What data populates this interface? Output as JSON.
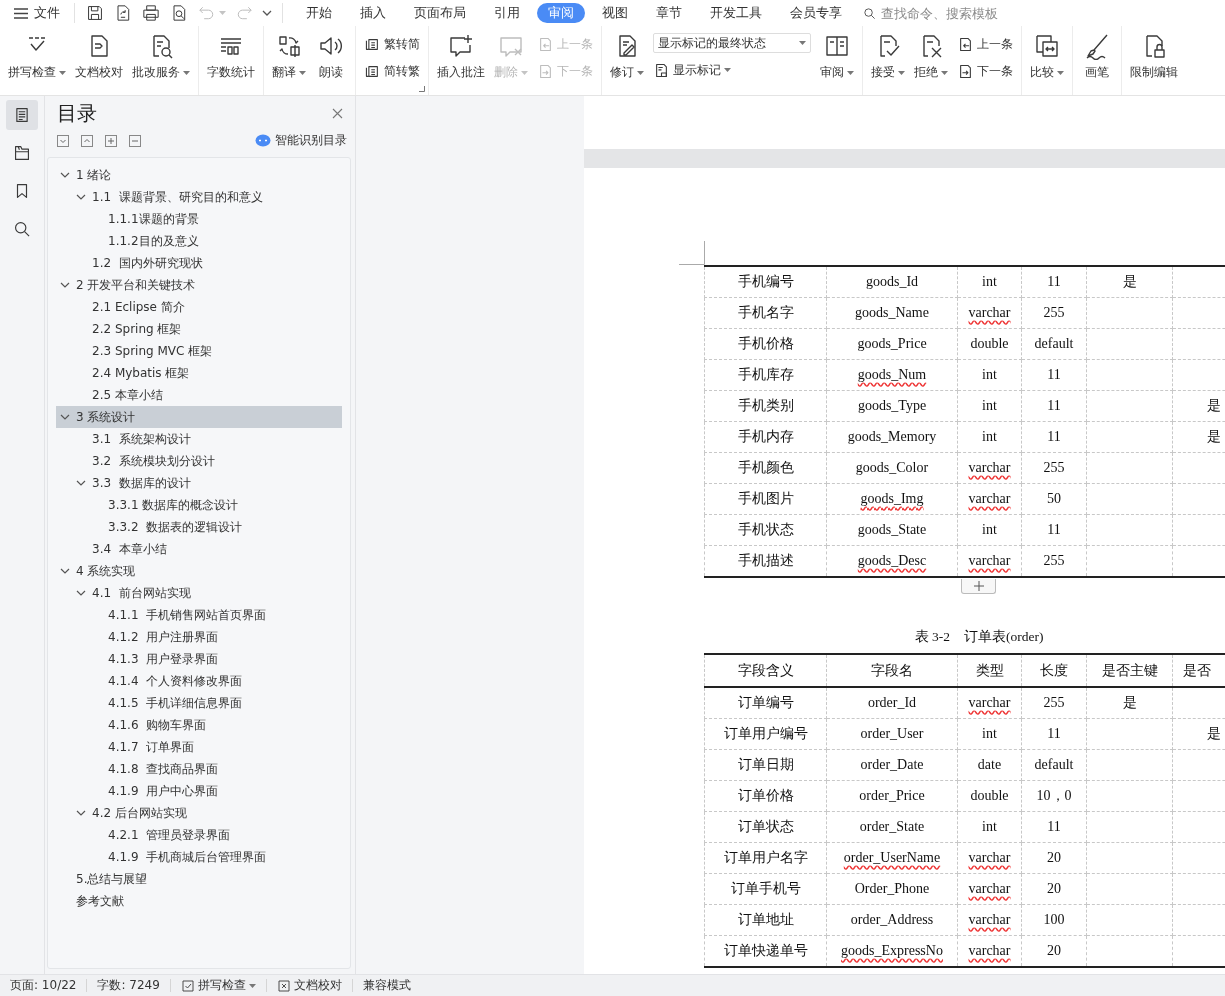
{
  "menu_bar": {
    "file_label": "文件",
    "quick_access": [
      {
        "disabled": false
      },
      {
        "disabled": false
      },
      {
        "disabled": false
      },
      {
        "disabled": false
      },
      {
        "disabled": true
      },
      {
        "disabled": true
      }
    ],
    "tabs": [
      {
        "label": "开始",
        "selected": false
      },
      {
        "label": "插入",
        "selected": false
      },
      {
        "label": "页面布局",
        "selected": false
      },
      {
        "label": "引用",
        "selected": false
      },
      {
        "label": "审阅",
        "selected": true
      },
      {
        "label": "视图",
        "selected": false
      },
      {
        "label": "章节",
        "selected": false
      },
      {
        "label": "开发工具",
        "selected": false
      },
      {
        "label": "会员专享",
        "selected": false
      }
    ],
    "search": {
      "placeholder": "查找命令、搜索模板"
    }
  },
  "ribbon": {
    "groups": [
      {
        "launcher": false,
        "items": [
          {
            "kind": "large",
            "label": "拼写检查",
            "dropdown": true,
            "disabled": false
          },
          {
            "kind": "large",
            "label": "文档校对",
            "dropdown": false,
            "disabled": false
          },
          {
            "kind": "large",
            "label": "批改服务",
            "dropdown": true,
            "disabled": false
          }
        ]
      },
      {
        "launcher": false,
        "items": [
          {
            "kind": "large",
            "label": "字数统计",
            "dropdown": false,
            "disabled": false
          }
        ]
      },
      {
        "launcher": false,
        "items": [
          {
            "kind": "large",
            "label": "翻译",
            "dropdown": true,
            "disabled": false
          },
          {
            "kind": "large",
            "label": "朗读",
            "dropdown": false,
            "disabled": false
          }
        ]
      },
      {
        "launcher": true,
        "items": [
          {
            "kind": "stack",
            "rows": [
              {
                "kind": "button",
                "label": "繁转简",
                "dropdown": false,
                "disabled": false
              },
              {
                "kind": "button",
                "label": "简转繁",
                "dropdown": false,
                "disabled": false
              }
            ]
          }
        ]
      },
      {
        "launcher": false,
        "items": [
          {
            "kind": "large",
            "label": "插入批注",
            "dropdown": false,
            "disabled": false
          },
          {
            "kind": "large",
            "label": "删除",
            "dropdown": true,
            "disabled": true
          },
          {
            "kind": "stack",
            "rows": [
              {
                "kind": "button",
                "label": "上一条",
                "dropdown": false,
                "disabled": true
              },
              {
                "kind": "button",
                "label": "下一条",
                "dropdown": false,
                "disabled": true
              }
            ]
          }
        ]
      },
      {
        "launcher": false,
        "items": [
          {
            "kind": "large",
            "label": "修订",
            "dropdown": true,
            "disabled": false
          },
          {
            "kind": "stack",
            "rows": [
              {
                "kind": "select",
                "value": "显示标记的最终状态"
              },
              {
                "kind": "button",
                "label": "显示标记",
                "dropdown": true,
                "disabled": false
              }
            ]
          },
          {
            "kind": "large",
            "label": "审阅",
            "dropdown": true,
            "disabled": false
          }
        ]
      },
      {
        "launcher": false,
        "items": [
          {
            "kind": "large",
            "label": "接受",
            "dropdown": true,
            "disabled": false
          },
          {
            "kind": "large",
            "label": "拒绝",
            "dropdown": true,
            "disabled": false
          },
          {
            "kind": "stack",
            "rows": [
              {
                "kind": "button",
                "label": "上一条",
                "dropdown": false,
                "disabled": false
              },
              {
                "kind": "button",
                "label": "下一条",
                "dropdown": false,
                "disabled": false
              }
            ]
          }
        ]
      },
      {
        "launcher": false,
        "items": [
          {
            "kind": "large",
            "label": "比较",
            "dropdown": true,
            "disabled": false
          }
        ]
      },
      {
        "launcher": false,
        "items": [
          {
            "kind": "large",
            "label": "画笔",
            "dropdown": false,
            "disabled": false
          }
        ]
      },
      {
        "launcher": false,
        "items": [
          {
            "kind": "large",
            "label": "限制编辑",
            "dropdown": false,
            "disabled": false
          }
        ]
      }
    ]
  },
  "nav_rail": [
    {
      "selected": true
    },
    {
      "selected": false
    },
    {
      "selected": false
    },
    {
      "selected": false
    }
  ],
  "outline": {
    "title": "目录",
    "smart_button": "智能识别目录",
    "items": [
      {
        "label": "1 绪论",
        "expanded": true,
        "selected": false,
        "children": [
          {
            "label": "1.1  课题背景、研究目的和意义",
            "expanded": true,
            "selected": false,
            "children": [
              {
                "label": "1.1.1课题的背景",
                "selected": false
              },
              {
                "label": "1.1.2目的及意义",
                "selected": false
              }
            ]
          },
          {
            "label": "1.2  国内外研究现状",
            "selected": false
          }
        ]
      },
      {
        "label": "2 开发平台和关键技术",
        "expanded": true,
        "selected": false,
        "children": [
          {
            "label": "2.1 Eclipse 简介",
            "selected": false
          },
          {
            "label": "2.2 Spring 框架",
            "selected": false
          },
          {
            "label": "2.3 Spring MVC 框架",
            "selected": false
          },
          {
            "label": "2.4 Mybatis 框架",
            "selected": false
          },
          {
            "label": "2.5 本章小结",
            "selected": false
          }
        ]
      },
      {
        "label": "3 系统设计",
        "expanded": true,
        "selected": true,
        "children": [
          {
            "label": "3.1  系统架构设计",
            "selected": false
          },
          {
            "label": "3.2  系统模块划分设计",
            "selected": false
          },
          {
            "label": "3.3  数据库的设计",
            "expanded": true,
            "selected": false,
            "children": [
              {
                "label": "3.3.1 数据库的概念设计",
                "selected": false
              },
              {
                "label": "3.3.2  数据表的逻辑设计",
                "selected": false
              }
            ]
          },
          {
            "label": "3.4  本章小结",
            "selected": false
          }
        ]
      },
      {
        "label": "4 系统实现",
        "expanded": true,
        "selected": false,
        "children": [
          {
            "label": "4.1  前台网站实现",
            "expanded": true,
            "selected": false,
            "children": [
              {
                "label": "4.1.1  手机销售网站首页界面",
                "selected": false
              },
              {
                "label": "4.1.2  用户注册界面",
                "selected": false
              },
              {
                "label": "4.1.3  用户登录界面",
                "selected": false
              },
              {
                "label": "4.1.4  个人资料修改界面",
                "selected": false
              },
              {
                "label": "4.1.5  手机详细信息界面",
                "selected": false
              },
              {
                "label": "4.1.6  购物车界面",
                "selected": false
              },
              {
                "label": "4.1.7  订单界面",
                "selected": false
              },
              {
                "label": "4.1.8  查找商品界面",
                "selected": false
              },
              {
                "label": "4.1.9  用户中心界面",
                "selected": false
              }
            ]
          },
          {
            "label": "4.2 后台网站实现",
            "expanded": true,
            "selected": false,
            "children": [
              {
                "label": "4.2.1  管理员登录界面",
                "selected": false
              },
              {
                "label": "4.1.9  手机商城后台管理界面",
                "selected": false
              }
            ]
          }
        ]
      },
      {
        "label": "5.总结与展望",
        "selected": false
      },
      {
        "label": "参考文献",
        "selected": false
      }
    ]
  },
  "document": {
    "table_1": {
      "rows": [
        {
          "column_1": "手机编号",
          "column_2": "goods_Id",
          "column_3": "int",
          "column_4": "11",
          "column_5": "是"
        },
        {
          "column_1": "手机名字",
          "column_2": "goods_Name",
          "column_3": "varchar",
          "column_4": "255",
          "spell_errors": {
            "column_3": true
          }
        },
        {
          "column_1": "手机价格",
          "column_2": "goods_Price",
          "column_3": "double",
          "column_4": "default"
        },
        {
          "column_1": "手机库存",
          "column_2": "goods_Num",
          "column_3": "int",
          "column_4": "11",
          "spell_errors": {
            "column_2": true
          }
        },
        {
          "column_1": "手机类别",
          "column_2": "goods_Type",
          "column_3": "int",
          "column_4": "11",
          "column_6": "是"
        },
        {
          "column_1": "手机内存",
          "column_2": "goods_Memory",
          "column_3": "int",
          "column_4": "11",
          "column_6": "是"
        },
        {
          "column_1": "手机颜色",
          "column_2": "goods_Color",
          "column_3": "varchar",
          "column_4": "255",
          "spell_errors": {
            "column_3": true
          }
        },
        {
          "column_1": "手机图片",
          "column_2": "goods_Img",
          "column_3": "varchar",
          "column_4": "50",
          "spell_errors": {
            "column_2": true,
            "column_3": true
          }
        },
        {
          "column_1": "手机状态",
          "column_2": "goods_State",
          "column_3": "int",
          "column_4": "11"
        },
        {
          "column_1": "手机描述",
          "column_2": "goods_Desc",
          "column_3": "varchar",
          "column_4": "255",
          "spell_errors": {
            "column_2": true,
            "column_3": true
          }
        }
      ]
    },
    "table_2": {
      "caption": "表 3-2　订单表(order)",
      "columns": [
        "字段含义",
        "字段名",
        "类型",
        "长度",
        "是否主键",
        "是否"
      ],
      "rows": [
        {
          "column_1": "订单编号",
          "column_2": "order_Id",
          "column_3": "varchar",
          "column_4": "255",
          "column_5": "是",
          "spell_errors": {
            "column_3": true
          }
        },
        {
          "column_1": "订单用户编号",
          "column_2": "order_User",
          "column_3": "int",
          "column_4": "11",
          "column_6": "是"
        },
        {
          "column_1": "订单日期",
          "column_2": "order_Date",
          "column_3": "date",
          "column_4": "default"
        },
        {
          "column_1": "订单价格",
          "column_2": "order_Price",
          "column_3": "double",
          "column_4": "10，0"
        },
        {
          "column_1": "订单状态",
          "column_2": "order_State",
          "column_3": "int",
          "column_4": "11"
        },
        {
          "column_1": "订单用户名字",
          "column_2": "order_UserName",
          "column_3": "varchar",
          "column_4": "20",
          "spell_errors": {
            "column_2": true,
            "column_3": true
          }
        },
        {
          "column_1": "订单手机号",
          "column_2": "Order_Phone",
          "column_3": "varchar",
          "column_4": "20",
          "spell_errors": {
            "column_3": true
          }
        },
        {
          "column_1": "订单地址",
          "column_2": "order_Address",
          "column_3": "varchar",
          "column_4": "100",
          "spell_errors": {
            "column_3": true
          }
        },
        {
          "column_1": "订单快递单号",
          "column_2": "goods_ExpressNo",
          "column_3": "varchar",
          "column_4": "20",
          "spell_errors": {
            "column_2": true,
            "column_3": true
          }
        }
      ]
    }
  },
  "status_bar": {
    "items": [
      {
        "kind": "info",
        "text": "页面: 10/22"
      },
      {
        "kind": "info",
        "text": "字数: 7249"
      },
      {
        "kind": "button",
        "text": "拼写检查",
        "dropdown": true
      },
      {
        "kind": "button",
        "text": "文档校对",
        "dropdown": false
      },
      {
        "kind": "info",
        "text": "兼容模式"
      }
    ]
  }
}
